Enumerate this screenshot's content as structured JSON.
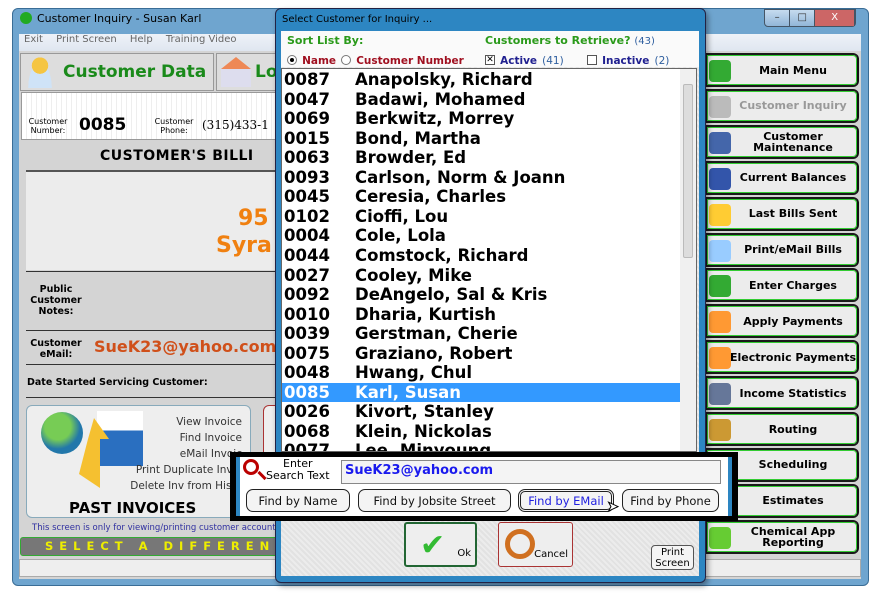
{
  "main_window": {
    "title": "Customer Inquiry  -  Susan   Karl",
    "menu": [
      "Exit",
      "Print Screen",
      "Help",
      "Training Video"
    ],
    "window_controls": {
      "minimize": "–",
      "maximize": "□",
      "close": "X"
    },
    "tabs": [
      "Customer Data",
      "Lo"
    ],
    "customer_number_label": "Customer Number:",
    "customer_number": "0085",
    "customer_phone_label": "Customer Phone:",
    "customer_phone": "(315)433-1",
    "billing_title": "CUSTOMER'S BILLI",
    "billing_address_line1": "95",
    "billing_address_line2": "Syra",
    "notes_label": "Public Customer Notes:",
    "email_label": "Customer eMail:",
    "email": "SueK23@yahoo.com",
    "date_started_label": "Date Started Servicing Customer:",
    "past_invoices": {
      "title": "PAST INVOICES",
      "items": [
        "View Invoice",
        "Find Invoice",
        "eMail Invoic",
        "Print Duplicate Invoi",
        "Delete Inv from Histo"
      ]
    },
    "notice": "This screen is only for viewing/printing customer account",
    "select_different": "SELECT A DIFFERENT CUS"
  },
  "sidebar": [
    {
      "label": "Main Menu",
      "icon": "bug-logo-icon",
      "color": "#3a3"
    },
    {
      "label": "Customer Inquiry",
      "icon": "magnifier-person-icon",
      "color": "#bbb",
      "disabled": true
    },
    {
      "label": "Customer Maintenance",
      "icon": "tools-person-icon",
      "color": "#46a"
    },
    {
      "label": "Current Balances",
      "icon": "binoculars-person-icon",
      "color": "#35a"
    },
    {
      "label": "Last Bills Sent",
      "icon": "bills-icon",
      "color": "#fc3"
    },
    {
      "label": "Print/eMail Bills",
      "icon": "envelope-icon",
      "color": "#9cf"
    },
    {
      "label": "Enter Charges",
      "icon": "dollar-icon",
      "color": "#3a3"
    },
    {
      "label": "Apply Payments",
      "icon": "piggy-bank-icon",
      "color": "#f93"
    },
    {
      "label": "Electronic Payments",
      "icon": "piggy-card-icon",
      "color": "#f93"
    },
    {
      "label": "Income Statistics",
      "icon": "pot-of-gold-icon",
      "color": "#679"
    },
    {
      "label": "Routing",
      "icon": "signpost-truck-icon",
      "color": "#c93"
    },
    {
      "label": "Scheduling",
      "icon": "calendar-icon",
      "color": "#888"
    },
    {
      "label": "Estimates",
      "icon": "estimate-icon",
      "color": "#888"
    },
    {
      "label": "Chemical App Reporting",
      "icon": "chemical-icon",
      "color": "#6c3"
    }
  ],
  "dialog": {
    "title": "Select Customer for Inquiry ...",
    "sort_label": "Sort List By:",
    "sort_options": [
      {
        "label": "Name",
        "selected": true
      },
      {
        "label": "Customer Number",
        "selected": false
      }
    ],
    "retrieve_label": "Customers to Retrieve?",
    "retrieve_count": "(43)",
    "active": {
      "label": "Active",
      "count": "(41)",
      "checked": true
    },
    "inactive": {
      "label": "Inactive",
      "count": "(2)",
      "checked": false
    },
    "customers": [
      {
        "num": "0087",
        "name": "Anapolsky, Richard"
      },
      {
        "num": "0047",
        "name": "Badawi, Mohamed"
      },
      {
        "num": "0069",
        "name": "Berkwitz, Morrey"
      },
      {
        "num": "0015",
        "name": "Bond, Martha"
      },
      {
        "num": "0063",
        "name": "Browder, Ed"
      },
      {
        "num": "0093",
        "name": "Carlson, Norm & Joann"
      },
      {
        "num": "0045",
        "name": "Ceresia, Charles"
      },
      {
        "num": "0102",
        "name": "Cioffi, Lou"
      },
      {
        "num": "0004",
        "name": "Cole, Lola"
      },
      {
        "num": "0044",
        "name": "Comstock, Richard"
      },
      {
        "num": "0027",
        "name": "Cooley, Mike"
      },
      {
        "num": "0092",
        "name": "DeAngelo, Sal & Kris"
      },
      {
        "num": "0010",
        "name": "Dharia, Kurtish"
      },
      {
        "num": "0039",
        "name": "Gerstman, Cherie"
      },
      {
        "num": "0075",
        "name": "Graziano, Robert"
      },
      {
        "num": "0048",
        "name": "Hwang, Chul"
      },
      {
        "num": "0085",
        "name": "Karl, Susan",
        "selected": true
      },
      {
        "num": "0026",
        "name": "Kivort, Stanley"
      },
      {
        "num": "0068",
        "name": "Klein, Nickolas"
      },
      {
        "num": "0077",
        "name": "Lee, Minyoung"
      }
    ],
    "ok_label": "Ok",
    "cancel_label": "Cancel",
    "print_screen_label": "Print Screen"
  },
  "search": {
    "label_line1": "Enter",
    "label_line2": "Search Text",
    "value": "SueK23@yahoo.com",
    "buttons": [
      "Find by Name",
      "Find by Jobsite Street",
      "Find by EMail",
      "Find by Phone"
    ],
    "active_button": "Find by EMail"
  }
}
